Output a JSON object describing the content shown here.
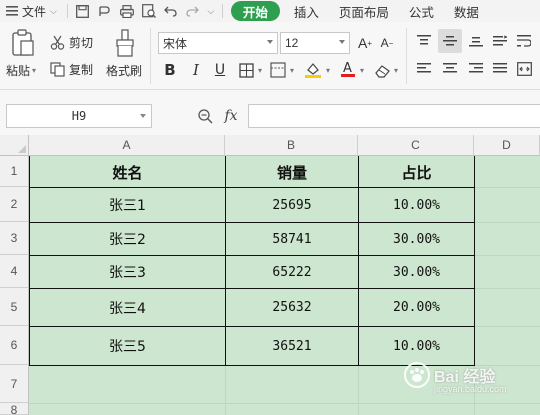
{
  "menubar": {
    "file_label": "文件",
    "tabs": [
      "开始",
      "插入",
      "页面布局",
      "公式",
      "数据"
    ],
    "active_tab": "开始"
  },
  "ribbon": {
    "paste_label": "粘贴",
    "cut_label": "剪切",
    "copy_label": "复制",
    "format_painter_label": "格式刷",
    "font_family": "宋体",
    "font_size": "12",
    "font_color": "#e02020",
    "fill_color": "#f5d000"
  },
  "formula_bar": {
    "cell_ref": "H9",
    "fx_label": "fx",
    "formula": ""
  },
  "sheet": {
    "columns": [
      "A",
      "B",
      "C",
      "D"
    ],
    "rows": [
      "1",
      "2",
      "3",
      "4",
      "5",
      "6",
      "7",
      "8"
    ],
    "header": [
      "姓名",
      "销量",
      "占比"
    ],
    "data": [
      [
        "张三1",
        "25695",
        "10.00%"
      ],
      [
        "张三2",
        "58741",
        "30.00%"
      ],
      [
        "张三3",
        "65222",
        "30.00%"
      ],
      [
        "张三4",
        "25632",
        "20.00%"
      ],
      [
        "张三5",
        "36521",
        "10.00%"
      ]
    ],
    "fill_color": "#cde6cf"
  },
  "watermark": {
    "text": "Bai 经验",
    "sub": "jingyan.baidu.com"
  }
}
